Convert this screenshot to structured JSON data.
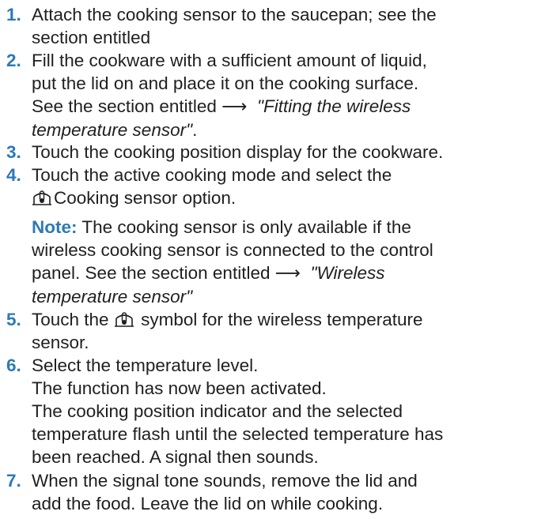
{
  "steps": [
    {
      "number": "1.",
      "lines": [
        "Attach the cooking sensor to the saucepan; see the",
        "section entitled"
      ]
    },
    {
      "number": "2.",
      "lines": [
        "Fill the cookware with a sufficient amount of liquid,",
        "put the lid on and place it on the cooking surface."
      ],
      "see_prefix": "See the section entitled",
      "arrow": "⟶",
      "link_part1": "\"Fitting the wireless",
      "link_part2": "temperature sensor\"",
      "link_suffix": "."
    },
    {
      "number": "3.",
      "lines": [
        "Touch the cooking position display for the cookware."
      ]
    },
    {
      "number": "4.",
      "line1": "Touch the active cooking mode and select the",
      "icon": "cooking-sensor-icon",
      "option_label": "Cooking sensor option.",
      "note_label": "Note:",
      "note_line1": "The cooking sensor is only available if the",
      "note_line2": "wireless cooking sensor is connected to the control",
      "note_line3_prefix": "panel. See the section entitled",
      "arrow": "⟶",
      "note_link_part1": "\"Wireless",
      "note_link_part2": "temperature sensor\""
    },
    {
      "number": "5.",
      "prefix": "Touch the",
      "icon": "cooking-sensor-icon",
      "suffix": "symbol for the wireless temperature",
      "line2": "sensor."
    },
    {
      "number": "6.",
      "lines": [
        "Select the temperature level.",
        "The function has now been activated.",
        "The cooking position indicator and the selected",
        "temperature flash until the selected temperature has",
        "been reached. A signal then sounds."
      ]
    },
    {
      "number": "7.",
      "lines": [
        "When the signal tone sounds, remove the lid and",
        "add the food. Leave the lid on while cooking."
      ]
    }
  ],
  "colors": {
    "accent": "#2e79b5",
    "text": "#1f1f1f"
  }
}
